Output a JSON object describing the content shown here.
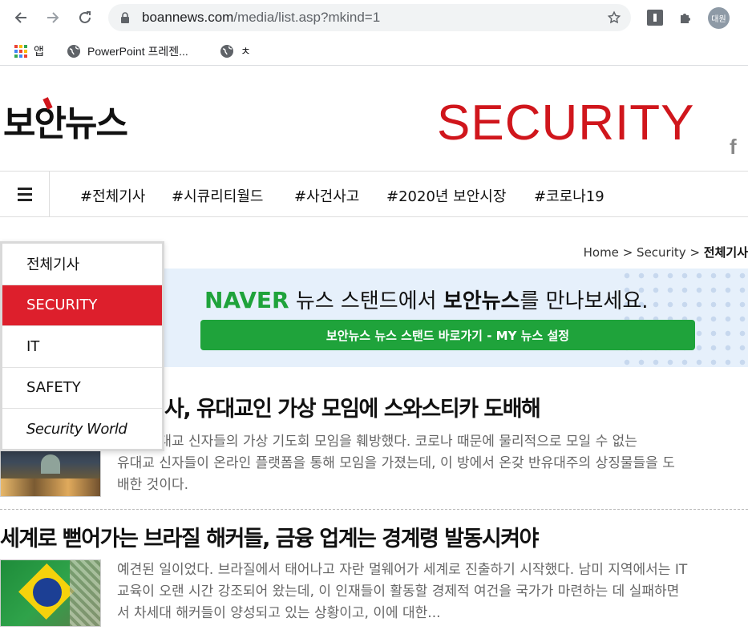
{
  "browser": {
    "url_host": "boannews.com",
    "url_path": "/media/list.asp?mkind=1",
    "profile_label": "대원",
    "bookmarks": [
      {
        "label": "앱",
        "icon": "apps-grid-icon"
      },
      {
        "label": "PowerPoint 프레젠...",
        "icon": "globe-icon"
      },
      {
        "label": "ㅊ",
        "icon": "globe-icon"
      }
    ]
  },
  "site": {
    "logo_text": "보안뉴스",
    "section_title": "SECURITY",
    "facebook_label": "f"
  },
  "menu": {
    "tags": [
      "#전체기사",
      "#시큐리티월드",
      "#사건사고",
      "#2020년 보안시장",
      "#코로나19"
    ]
  },
  "breadcrumb": {
    "home": "Home",
    "sep": ">",
    "section": "Security",
    "current": "전체기사"
  },
  "banner": {
    "naver": "NAVER",
    "text_pre": " 뉴스 스탠드에서 ",
    "text_bold": "보안뉴스",
    "text_post": "를 만나보세요.",
    "button": "보안뉴스 뉴스 스탠드 바로가기 - MY 뉴스 설정"
  },
  "dropdown": {
    "items": [
      "전체기사",
      "SECURITY",
      "IT",
      "SAFETY",
      "Security World"
    ],
    "active_index": 1
  },
  "articles": [
    {
      "title": "사, 유대교인 가상 모임에 스와스티카 도배해",
      "body_line1": "커가 유대교 신자들의 가상 기도회 모임을 훼방했다. 코로나 때문에 물리적으로 모일 수 없는",
      "body_line2": "유대교 신자들이 온라인 플랫폼을 통해 모임을 가졌는데, 이 방에서 온갖 반유대주의 상징물들을 도",
      "body_line3": "배한 것이다."
    },
    {
      "title": "세계로 뻗어가는 브라질 해커들, 금융 업계는 경계령 발동시켜야",
      "body_line1": "예견된 일이었다. 브라질에서 태어나고 자란 멀웨어가 세계로 진출하기 시작했다. 남미 지역에서는 IT",
      "body_line2": "교육이 오랜 시간 강조되어 왔는데, 이 인재들이 활동할 경제적 여건을 국가가 마련하는 데 실패하면",
      "body_line3": "서 차세대 해커들이 양성되고 있는 상황이고, 이에 대한..."
    }
  ],
  "colors": {
    "brand_red": "#d0161c",
    "active_red": "#dd1f2c",
    "naver_green": "#1fa33b"
  }
}
